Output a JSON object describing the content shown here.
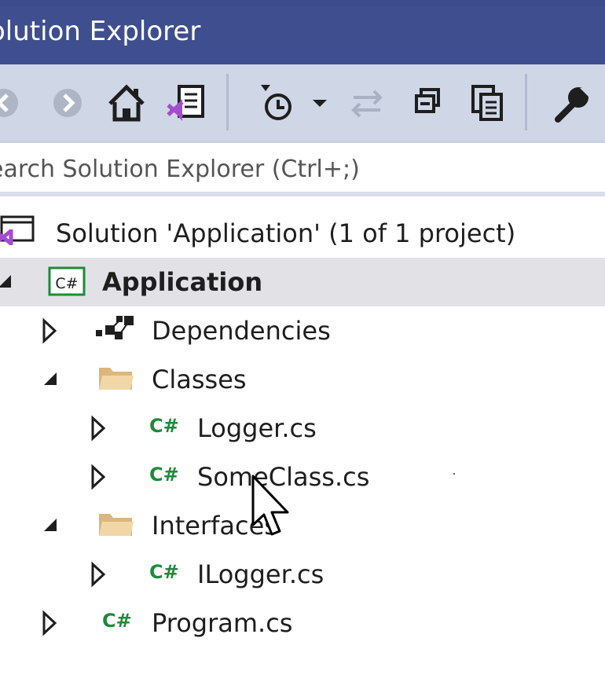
{
  "window": {
    "title": "olution Explorer"
  },
  "toolbar": {
    "buttons": [
      {
        "name": "back-button",
        "icon": "arrow-left-icon"
      },
      {
        "name": "forward-button",
        "icon": "arrow-right-icon"
      },
      {
        "name": "home-button",
        "icon": "home-icon"
      },
      {
        "name": "switch-views-button",
        "icon": "vs-solution-view-icon"
      },
      {
        "name": "pending-changes-filter-button",
        "icon": "clock-filter-icon"
      },
      {
        "name": "filter-dropdown-button",
        "icon": "dropdown-arrow-icon"
      },
      {
        "name": "sync-active-document-button",
        "icon": "sync-arrows-icon"
      },
      {
        "name": "collapse-all-button",
        "icon": "collapse-all-icon"
      },
      {
        "name": "show-all-files-button",
        "icon": "copy-files-icon"
      },
      {
        "name": "properties-button",
        "icon": "wrench-icon"
      }
    ]
  },
  "search": {
    "placeholder": "earch Solution Explorer (Ctrl+;)"
  },
  "tree": {
    "solution": {
      "label": "Solution 'Application' (1 of 1 project)",
      "icon": "vs-solution-icon"
    },
    "project": {
      "label": "Application",
      "icon": "csharp-project-icon",
      "expanded": true,
      "selected": true
    },
    "items": [
      {
        "label": "Dependencies",
        "icon": "dependencies-icon",
        "expanded": false
      },
      {
        "label": "Classes",
        "icon": "folder-icon",
        "expanded": true
      },
      {
        "label": "Logger.cs",
        "icon": "csharp-file-icon",
        "expanded": false
      },
      {
        "label": "SomeClass.cs",
        "icon": "csharp-file-icon",
        "expanded": false
      },
      {
        "label": "Interfaces",
        "icon": "folder-icon",
        "expanded": true
      },
      {
        "label": "ILogger.cs",
        "icon": "csharp-file-icon",
        "expanded": false
      },
      {
        "label": "Program.cs",
        "icon": "csharp-file-icon",
        "expanded": false
      }
    ],
    "csharp_glyph": "C#"
  },
  "colors": {
    "title_bar": "#3f4e8f",
    "toolbar": "#cfd6e5",
    "selected_row": "#e2e2e6",
    "csharp_green": "#1e8a3a",
    "folder": "#dcb67a",
    "vs_purple": "#a44ccf"
  }
}
